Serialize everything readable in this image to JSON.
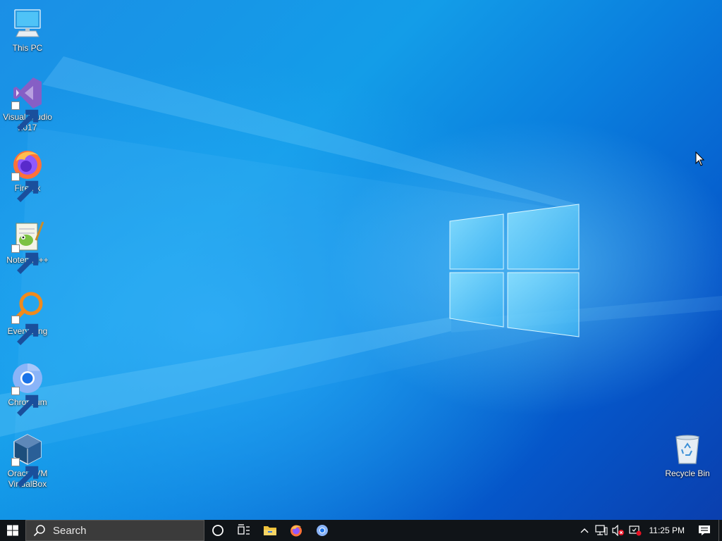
{
  "desktop": {
    "icons": [
      {
        "label": "This PC",
        "icon": "this-pc-icon"
      },
      {
        "label": "Visual Studio 2017",
        "icon": "visual-studio-icon"
      },
      {
        "label": "Firefox",
        "icon": "firefox-icon"
      },
      {
        "label": "Notepad++",
        "icon": "notepad-plus-plus-icon"
      },
      {
        "label": "Everything",
        "icon": "everything-search-icon"
      },
      {
        "label": "Chromium",
        "icon": "chromium-icon"
      },
      {
        "label": "Oracle VM VirtualBox",
        "icon": "virtualbox-icon"
      }
    ],
    "recycle_bin": {
      "label": "Recycle Bin",
      "icon": "recycle-bin-icon"
    }
  },
  "taskbar": {
    "search_placeholder": "Search",
    "pinned": [
      "cortana-icon",
      "task-view-icon",
      "file-explorer-icon",
      "firefox-icon",
      "chromium-icon"
    ],
    "tray_icons": [
      "chevron-up-icon",
      "network-icon",
      "volume-muted-icon",
      "security-warning-icon"
    ],
    "clock": "11:25 PM"
  },
  "colors": {
    "taskbar": "#101418",
    "search_box": "#3b3b3b",
    "desktop_accent": "#0a7fde"
  }
}
